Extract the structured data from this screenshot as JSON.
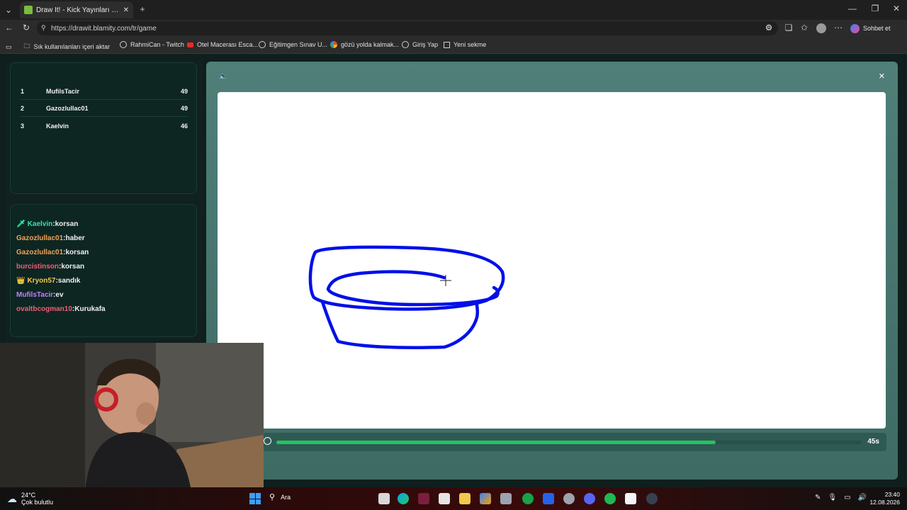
{
  "browser": {
    "tab_title": "Draw It! - Kick Yayınları İçin Ç",
    "url": "https://drawit.blamity.com/tr/game",
    "profile_button": "Sohbet et",
    "bookmarks": [
      "Sık kullanılanları içeri aktar",
      "RahmiCan - Twitch",
      "Otel Macerası Esca...",
      "Eğitimgen Sınav U...",
      "gözü yolda kalmak...",
      "Giriş Yap",
      "Yeni sekme"
    ]
  },
  "leaderboard": [
    {
      "rank": "1",
      "name": "MufilsTacir",
      "score": "49"
    },
    {
      "rank": "2",
      "name": "Gazozlullac01",
      "score": "49"
    },
    {
      "rank": "3",
      "name": "Kaelvin",
      "score": "46"
    }
  ],
  "chat": [
    {
      "user": "Kaelvin",
      "msg": ":korsan",
      "color": "#2ee6a6",
      "badge": "sword"
    },
    {
      "user": "Gazozlullac01",
      "msg": ":haber",
      "color": "#f4a259",
      "badge": ""
    },
    {
      "user": "Gazozlullac01",
      "msg": ":korsan",
      "color": "#f4a259",
      "badge": ""
    },
    {
      "user": "burcistinson",
      "msg": ":korsan",
      "color": "#f25c7a",
      "badge": ""
    },
    {
      "user": "Kryon57",
      "msg": ":sandık",
      "color": "#f2c94c",
      "badge": "crown"
    },
    {
      "user": "MufilsTacir",
      "msg": ":ev",
      "color": "#c77dff",
      "badge": ""
    },
    {
      "user": "ovaltbcogman10",
      "msg": ":Kurukafa",
      "color": "#f25c7a",
      "badge": ""
    }
  ],
  "game": {
    "timer_text": "45s",
    "progress": 0.75,
    "accent": "#22c55e"
  },
  "taskbar": {
    "weather_temp": "24°C",
    "weather_desc": "Çok bulutlu",
    "search_label": "Ara",
    "time": "23:40",
    "date": "12.08.2026"
  }
}
